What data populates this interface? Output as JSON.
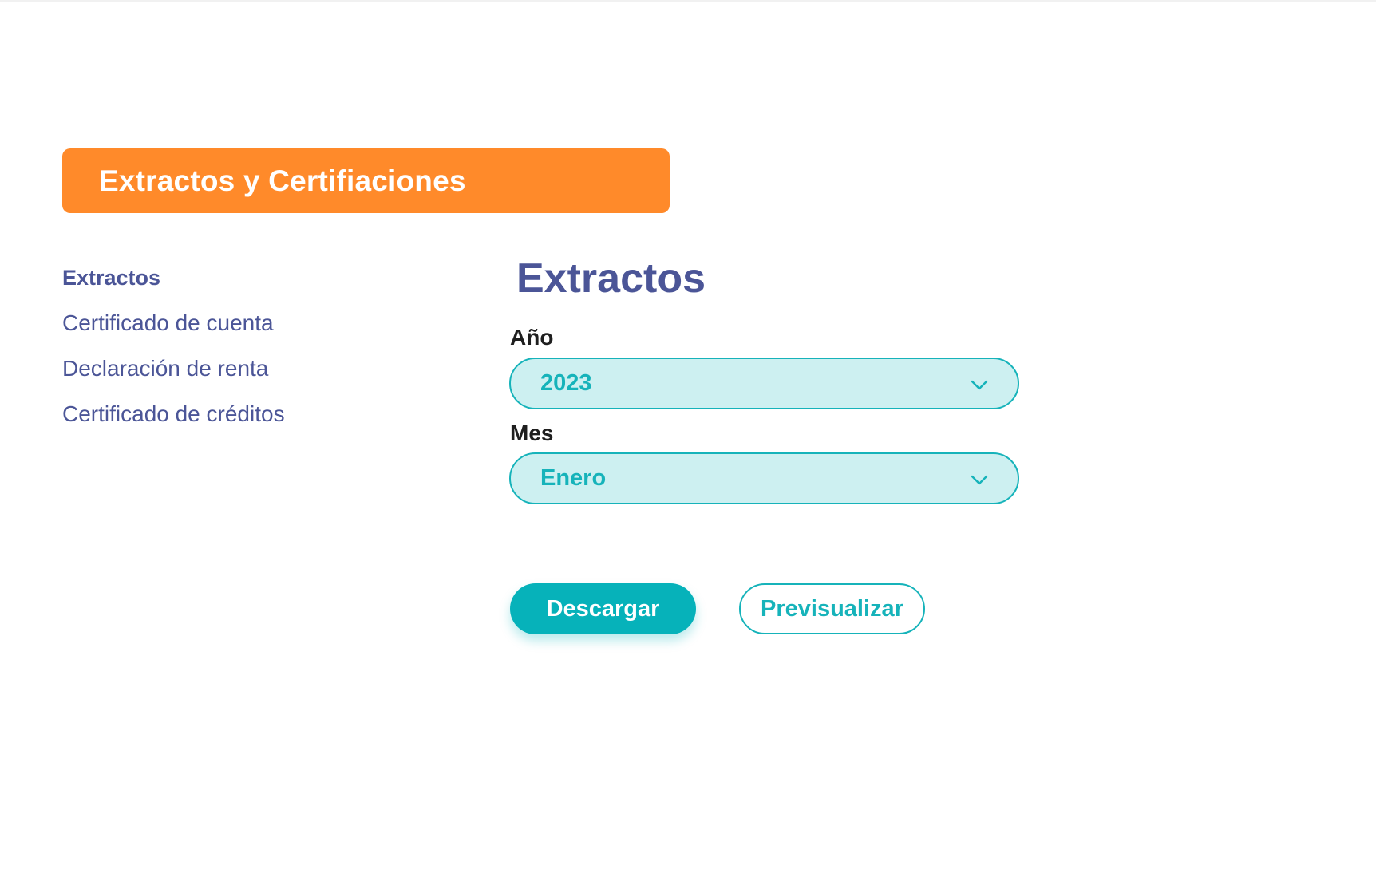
{
  "banner": {
    "title": "Extractos y Certifiaciones"
  },
  "sidebar": {
    "items": [
      {
        "label": "Extractos",
        "active": true
      },
      {
        "label": "Certificado de cuenta",
        "active": false
      },
      {
        "label": "Declaración de renta",
        "active": false
      },
      {
        "label": "Certificado de créditos",
        "active": false
      }
    ]
  },
  "main": {
    "title": "Extractos",
    "year_field": {
      "label": "Año",
      "value": "2023",
      "icon": "chevron-down-icon"
    },
    "month_field": {
      "label": "Mes",
      "value": "Enero",
      "icon": "chevron-down-icon"
    },
    "buttons": {
      "download_label": "Descargar",
      "preview_label": "Previsualizar"
    }
  },
  "colors": {
    "banner_orange": "#ff8a2a",
    "nav_text": "#4b5597",
    "teal": "#16b3ba",
    "select_bg": "#cdf0f1",
    "primary_button": "#06b2ba"
  }
}
